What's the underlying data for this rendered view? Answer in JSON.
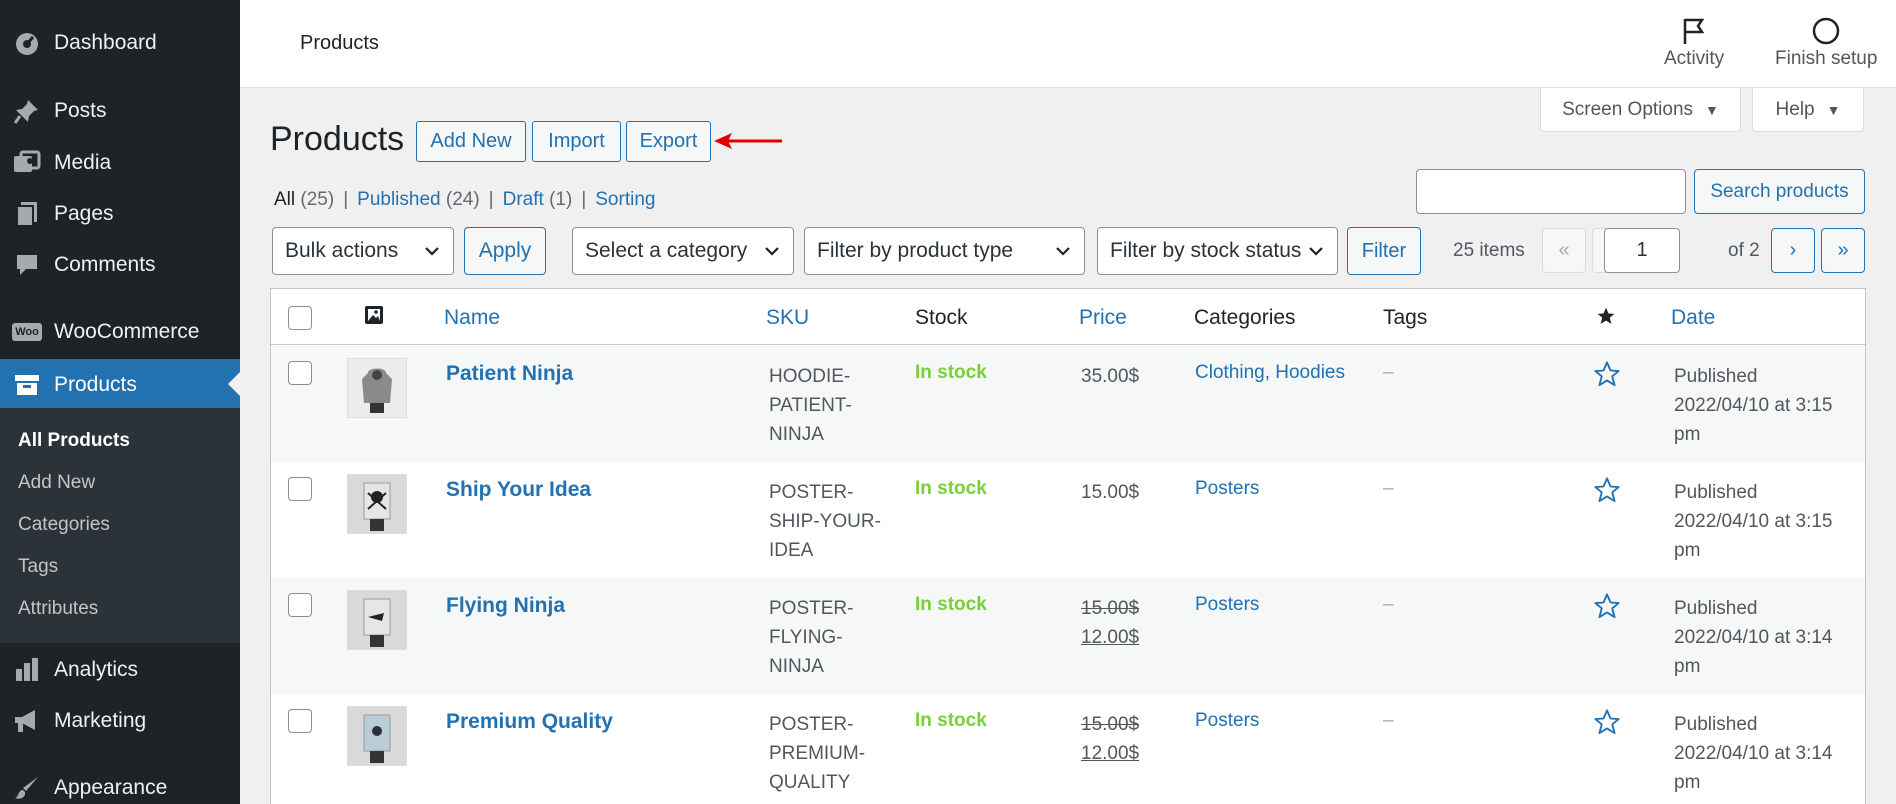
{
  "sidebar": {
    "items": [
      {
        "label": "Dashboard",
        "icon": "dashboard-icon"
      },
      {
        "label": "Posts",
        "icon": "pin-icon"
      },
      {
        "label": "Media",
        "icon": "media-icon"
      },
      {
        "label": "Pages",
        "icon": "pages-icon"
      },
      {
        "label": "Comments",
        "icon": "comment-icon"
      },
      {
        "label": "WooCommerce",
        "icon": "woo-icon"
      },
      {
        "label": "Products",
        "icon": "products-icon"
      },
      {
        "label": "Analytics",
        "icon": "bar-chart-icon"
      },
      {
        "label": "Marketing",
        "icon": "megaphone-icon"
      },
      {
        "label": "Appearance",
        "icon": "brush-icon"
      }
    ],
    "submenu": [
      "All Products",
      "Add New",
      "Categories",
      "Tags",
      "Attributes"
    ],
    "woo_badge": "Woo"
  },
  "topbar": {
    "title": "Products",
    "activity": "Activity",
    "finish_setup": "Finish setup"
  },
  "screen_meta": {
    "screen_options": "Screen Options",
    "help": "Help"
  },
  "page": {
    "title": "Products",
    "add_new": "Add New",
    "import": "Import",
    "export": "Export"
  },
  "views": {
    "all": "All",
    "all_count": "(25)",
    "published": "Published",
    "published_count": "(24)",
    "draft": "Draft",
    "draft_count": "(1)",
    "sorting": "Sorting",
    "sep": "|"
  },
  "search": {
    "button": "Search products",
    "value": ""
  },
  "filters": {
    "bulk_actions": "Bulk actions",
    "apply": "Apply",
    "category": "Select a category",
    "product_type": "Filter by product type",
    "stock_status": "Filter by stock status",
    "filter": "Filter"
  },
  "pagination": {
    "items": "25 items",
    "first": "«",
    "prev": "‹",
    "current": "1",
    "of": "of 2",
    "next": "›",
    "last": "»"
  },
  "table": {
    "headers": {
      "image": "image-icon",
      "name": "Name",
      "sku": "SKU",
      "stock": "Stock",
      "price": "Price",
      "categories": "Categories",
      "tags": "Tags",
      "featured": "star-icon",
      "date": "Date"
    },
    "rows": [
      {
        "name": "Patient Ninja",
        "sku": "HOODIE-PATIENT-NINJA",
        "stock": "In stock",
        "price_old": "",
        "price": "35.00$",
        "categories": "Clothing, Hoodies",
        "tags": "–",
        "date": "Published 2022/04/10 at 3:15 pm"
      },
      {
        "name": "Ship Your Idea",
        "sku": "POSTER-SHIP-YOUR-IDEA",
        "stock": "In stock",
        "price_old": "",
        "price": "15.00$",
        "categories": "Posters",
        "tags": "–",
        "date": "Published 2022/04/10 at 3:15 pm"
      },
      {
        "name": "Flying Ninja",
        "sku": "POSTER-FLYING-NINJA",
        "stock": "In stock",
        "price_old": "15.00$",
        "price": "12.00$",
        "categories": "Posters",
        "tags": "–",
        "date": "Published 2022/04/10 at 3:14 pm"
      },
      {
        "name": "Premium Quality",
        "sku": "POSTER-PREMIUM-QUALITY",
        "stock": "In stock",
        "price_old": "15.00$",
        "price": "12.00$",
        "categories": "Posters",
        "tags": "–",
        "date": "Published 2022/04/10 at 3:14 pm"
      }
    ]
  },
  "colors": {
    "accent": "#2271b1",
    "sidebar_bg": "#1d2327",
    "in_stock": "#7ad03a",
    "arrow": "#e00000"
  }
}
